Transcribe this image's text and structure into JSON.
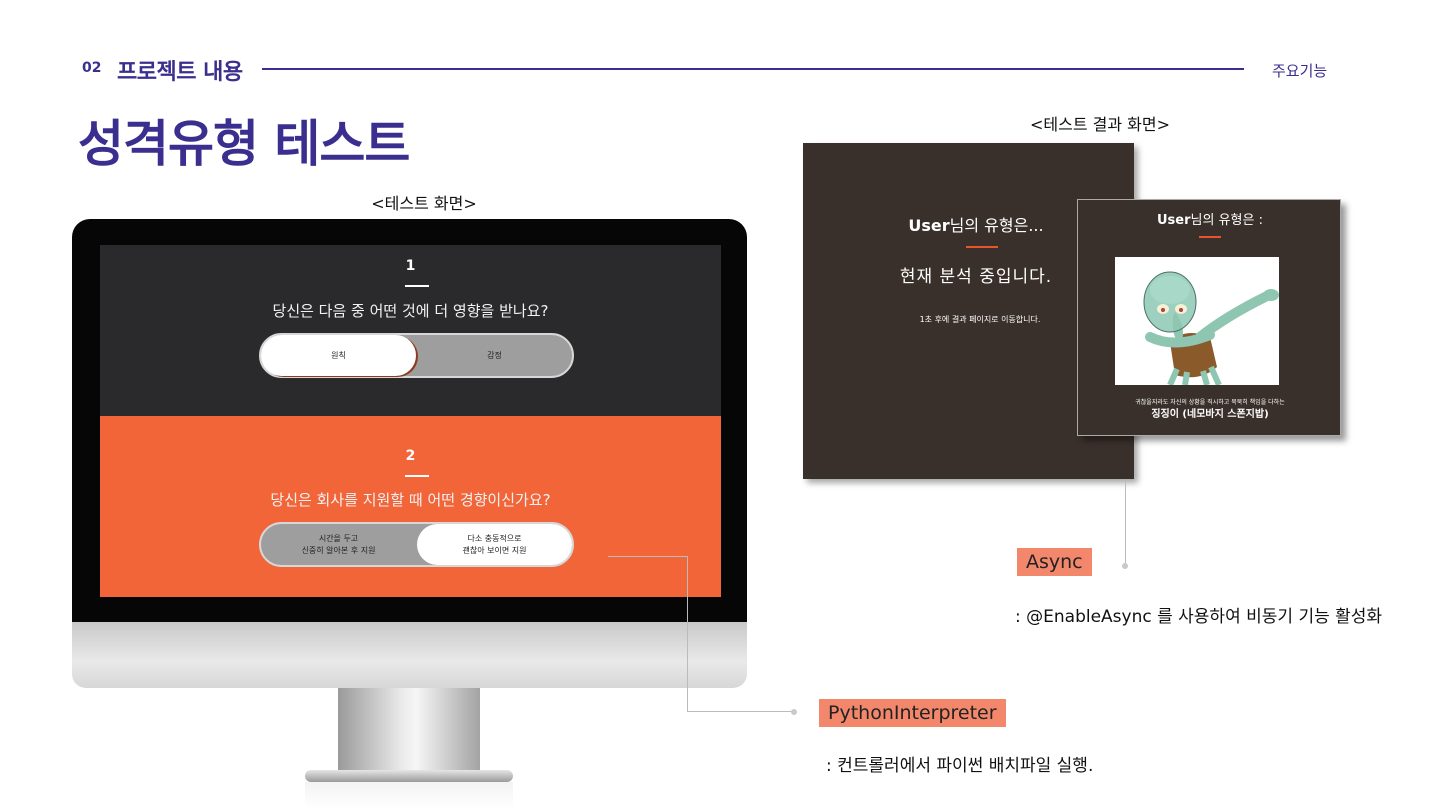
{
  "header": {
    "section_number": "02",
    "section_title": "프로젝트 내용",
    "section_right": "주요기능",
    "main_title": "성격유형 테스트"
  },
  "test_screen": {
    "caption": "<테스트 화면>",
    "question1": {
      "number": "1",
      "text": "당신은 다음 중 어떤 것에 더 영향을 받나요?",
      "option_a": "원칙",
      "option_b": "감정"
    },
    "question2": {
      "number": "2",
      "text": "당신은 회사를 지원할 때 어떤 경향이신가요?",
      "option_a_line1": "시간을 두고",
      "option_a_line2": "신중히 알아본 후 지원",
      "option_b_line1": "다소 충동적으로",
      "option_b_line2": "괜찮아 보이면 지원"
    }
  },
  "result_screen": {
    "caption": "<테스트 결과 화면>",
    "loading": {
      "user": "User",
      "title_suffix": "님의 유형은...",
      "status": "현재 분석 중입니다.",
      "notice": "1초 후에 결과 페이지로 이동합니다."
    },
    "result": {
      "user": "User",
      "title_suffix": "님의 유형은 :",
      "description": "귀찮을지라도 자신의 상황을 직시하고 묵묵히 책임을 다하는",
      "type_name": "징징이 (네모바지 스폰지밥)"
    }
  },
  "features": [
    {
      "tag": "Async",
      "description": ": @EnableAsync 를 사용하여 비동기 기능 활성화"
    },
    {
      "tag": "PythonInterpreter",
      "description": ": 컨트롤러에서 파이썬 배치파일 실행."
    }
  ]
}
